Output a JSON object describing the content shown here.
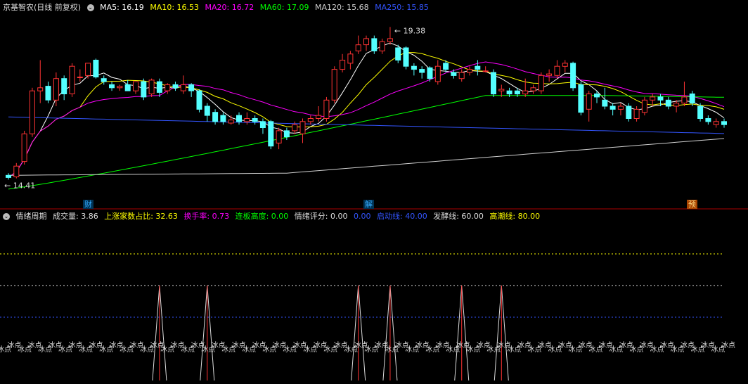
{
  "header": {
    "title": "京基智农(日线 前复权)",
    "ma": [
      {
        "label": "MA5: 16.19",
        "color": "#ffffff"
      },
      {
        "label": "MA10: 16.53",
        "color": "#ffff00"
      },
      {
        "label": "MA20: 16.72",
        "color": "#ff00ff"
      },
      {
        "label": "MA60: 17.09",
        "color": "#00ff00"
      },
      {
        "label": "MA120: 15.68",
        "color": "#d0d0d0"
      },
      {
        "label": "MA250: 15.85",
        "color": "#3355ff"
      }
    ]
  },
  "indicator_header": {
    "name": "情绪周期",
    "items": [
      {
        "label": "成交量: 3.86",
        "color": "#dddddd"
      },
      {
        "label": "上涨家数占比: 32.63",
        "color": "#ffff00"
      },
      {
        "label": "换手率: 0.73",
        "color": "#ff00ff"
      },
      {
        "label": "连板高度: 0.00",
        "color": "#00ff00"
      },
      {
        "label": "情绪评分: 0.00",
        "color": "#dddddd"
      },
      {
        "label": "0.00",
        "color": "#3355ff"
      },
      {
        "label": "启动线: 40.00",
        "color": "#3355ff"
      },
      {
        "label": "发酵线: 60.00",
        "color": "#dddddd"
      },
      {
        "label": "高潮线: 80.00",
        "color": "#ffff00"
      }
    ]
  },
  "markers": [
    {
      "label": "财",
      "color": "#33aaff"
    },
    {
      "label": "解",
      "color": "#33aaff"
    },
    {
      "label": "预",
      "color": "#ff8800"
    }
  ],
  "chart_data": [
    {
      "type": "candlestick",
      "title": "京基智农(日线 前复权)",
      "high_label": "19.38",
      "low_label": "14.41",
      "ylim": [
        13.8,
        19.8
      ],
      "candles": [
        {
          "o": 14.55,
          "c": 14.48,
          "h": 14.62,
          "l": 14.41
        },
        {
          "o": 14.5,
          "c": 14.85,
          "h": 14.95,
          "l": 14.45
        },
        {
          "o": 15.0,
          "c": 15.9,
          "h": 16.0,
          "l": 14.9
        },
        {
          "o": 15.9,
          "c": 17.3,
          "h": 17.4,
          "l": 15.8
        },
        {
          "o": 17.3,
          "c": 17.4,
          "h": 18.3,
          "l": 16.9
        },
        {
          "o": 17.45,
          "c": 17.0,
          "h": 17.6,
          "l": 16.9
        },
        {
          "o": 17.0,
          "c": 17.7,
          "h": 17.9,
          "l": 16.8
        },
        {
          "o": 17.7,
          "c": 17.2,
          "h": 17.8,
          "l": 17.0
        },
        {
          "o": 17.2,
          "c": 18.1,
          "h": 18.2,
          "l": 17.1
        },
        {
          "o": 17.75,
          "c": 17.75,
          "h": 18.0,
          "l": 17.6
        },
        {
          "o": 17.8,
          "c": 18.2,
          "h": 18.2,
          "l": 17.7
        },
        {
          "o": 18.3,
          "c": 17.75,
          "h": 18.35,
          "l": 17.7
        },
        {
          "o": 17.7,
          "c": 17.6,
          "h": 17.8,
          "l": 17.5
        },
        {
          "o": 17.5,
          "c": 17.4,
          "h": 17.6,
          "l": 17.3
        },
        {
          "o": 17.4,
          "c": 17.45,
          "h": 17.5,
          "l": 17.3
        },
        {
          "o": 17.5,
          "c": 17.3,
          "h": 17.65,
          "l": 17.3
        },
        {
          "o": 17.3,
          "c": 17.6,
          "h": 17.6,
          "l": 17.2
        },
        {
          "o": 17.6,
          "c": 17.1,
          "h": 17.7,
          "l": 17.0
        },
        {
          "o": 17.2,
          "c": 17.65,
          "h": 17.7,
          "l": 17.1
        },
        {
          "o": 17.6,
          "c": 17.25,
          "h": 17.7,
          "l": 17.1
        },
        {
          "o": 17.3,
          "c": 17.5,
          "h": 17.55,
          "l": 17.2
        },
        {
          "o": 17.5,
          "c": 17.4,
          "h": 17.6,
          "l": 17.3
        },
        {
          "o": 17.3,
          "c": 17.5,
          "h": 17.8,
          "l": 17.2
        },
        {
          "o": 17.5,
          "c": 17.3,
          "h": 17.55,
          "l": 17.1
        },
        {
          "o": 17.3,
          "c": 16.7,
          "h": 17.35,
          "l": 16.6
        },
        {
          "o": 16.8,
          "c": 16.5,
          "h": 16.9,
          "l": 16.3
        },
        {
          "o": 16.6,
          "c": 16.3,
          "h": 16.7,
          "l": 16.2
        },
        {
          "o": 16.5,
          "c": 16.3,
          "h": 16.6,
          "l": 16.2
        },
        {
          "o": 16.25,
          "c": 16.35,
          "h": 16.5,
          "l": 16.2
        },
        {
          "o": 16.5,
          "c": 16.3,
          "h": 16.6,
          "l": 16.2
        },
        {
          "o": 16.3,
          "c": 16.4,
          "h": 16.6,
          "l": 16.2
        },
        {
          "o": 16.4,
          "c": 16.3,
          "h": 16.5,
          "l": 16.2
        },
        {
          "o": 16.3,
          "c": 16.1,
          "h": 16.4,
          "l": 15.9
        },
        {
          "o": 16.3,
          "c": 15.5,
          "h": 16.35,
          "l": 15.4
        },
        {
          "o": 15.6,
          "c": 16.0,
          "h": 16.1,
          "l": 15.4
        },
        {
          "o": 16.0,
          "c": 15.8,
          "h": 16.1,
          "l": 15.7
        },
        {
          "o": 16.0,
          "c": 16.2,
          "h": 16.3,
          "l": 15.9
        },
        {
          "o": 15.9,
          "c": 16.3,
          "h": 16.4,
          "l": 15.6
        },
        {
          "o": 16.3,
          "c": 16.4,
          "h": 16.5,
          "l": 16.2
        },
        {
          "o": 16.4,
          "c": 16.5,
          "h": 16.8,
          "l": 16.3
        },
        {
          "o": 16.4,
          "c": 17.0,
          "h": 17.1,
          "l": 16.3
        },
        {
          "o": 17.0,
          "c": 18.0,
          "h": 18.1,
          "l": 16.9
        },
        {
          "o": 18.0,
          "c": 18.3,
          "h": 18.5,
          "l": 17.9
        },
        {
          "o": 18.2,
          "c": 18.5,
          "h": 18.6,
          "l": 18.0
        },
        {
          "o": 18.6,
          "c": 18.8,
          "h": 19.1,
          "l": 18.5
        },
        {
          "o": 18.8,
          "c": 19.0,
          "h": 19.1,
          "l": 18.6
        },
        {
          "o": 19.0,
          "c": 18.6,
          "h": 19.1,
          "l": 18.5
        },
        {
          "o": 18.6,
          "c": 18.9,
          "h": 19.0,
          "l": 18.5
        },
        {
          "o": 18.9,
          "c": 19.0,
          "h": 19.38,
          "l": 18.8
        },
        {
          "o": 18.7,
          "c": 18.3,
          "h": 18.8,
          "l": 18.2
        },
        {
          "o": 18.7,
          "c": 18.1,
          "h": 18.75,
          "l": 18.0
        },
        {
          "o": 18.1,
          "c": 18.0,
          "h": 18.2,
          "l": 17.8
        },
        {
          "o": 18.0,
          "c": 17.9,
          "h": 18.1,
          "l": 17.7
        },
        {
          "o": 18.05,
          "c": 17.7,
          "h": 18.1,
          "l": 17.6
        },
        {
          "o": 17.6,
          "c": 18.1,
          "h": 18.3,
          "l": 17.5
        },
        {
          "o": 18.2,
          "c": 18.0,
          "h": 18.3,
          "l": 17.9
        },
        {
          "o": 17.9,
          "c": 17.8,
          "h": 18.0,
          "l": 17.7
        },
        {
          "o": 17.7,
          "c": 17.9,
          "h": 18.0,
          "l": 17.6
        },
        {
          "o": 17.9,
          "c": 18.0,
          "h": 18.1,
          "l": 17.8
        },
        {
          "o": 18.1,
          "c": 18.0,
          "h": 18.3,
          "l": 17.8
        },
        {
          "o": 17.95,
          "c": 17.95,
          "h": 18.1,
          "l": 17.9
        },
        {
          "o": 17.9,
          "c": 17.2,
          "h": 18.0,
          "l": 17.1
        },
        {
          "o": 17.3,
          "c": 17.35,
          "h": 17.5,
          "l": 17.1
        },
        {
          "o": 17.3,
          "c": 17.2,
          "h": 17.4,
          "l": 17.1
        },
        {
          "o": 17.3,
          "c": 17.2,
          "h": 17.4,
          "l": 17.1
        },
        {
          "o": 17.2,
          "c": 17.3,
          "h": 17.7,
          "l": 17.1
        },
        {
          "o": 17.3,
          "c": 17.4,
          "h": 17.5,
          "l": 17.2
        },
        {
          "o": 17.3,
          "c": 17.8,
          "h": 17.9,
          "l": 17.2
        },
        {
          "o": 17.8,
          "c": 17.85,
          "h": 18.0,
          "l": 17.6
        },
        {
          "o": 17.8,
          "c": 18.1,
          "h": 18.3,
          "l": 17.7
        },
        {
          "o": 18.1,
          "c": 18.2,
          "h": 18.3,
          "l": 17.9
        },
        {
          "o": 18.2,
          "c": 17.4,
          "h": 18.25,
          "l": 17.3
        },
        {
          "o": 17.5,
          "c": 16.6,
          "h": 17.6,
          "l": 16.5
        },
        {
          "o": 16.7,
          "c": 17.2,
          "h": 17.3,
          "l": 16.3
        },
        {
          "o": 17.2,
          "c": 17.1,
          "h": 17.3,
          "l": 16.9
        },
        {
          "o": 17.0,
          "c": 16.8,
          "h": 17.4,
          "l": 16.7
        },
        {
          "o": 16.8,
          "c": 16.7,
          "h": 16.9,
          "l": 16.5
        },
        {
          "o": 16.7,
          "c": 16.8,
          "h": 16.9,
          "l": 16.5
        },
        {
          "o": 16.8,
          "c": 16.4,
          "h": 16.9,
          "l": 16.3
        },
        {
          "o": 16.4,
          "c": 16.7,
          "h": 16.8,
          "l": 16.3
        },
        {
          "o": 16.6,
          "c": 17.0,
          "h": 17.1,
          "l": 16.5
        },
        {
          "o": 17.0,
          "c": 17.1,
          "h": 17.2,
          "l": 16.8
        },
        {
          "o": 17.1,
          "c": 17.0,
          "h": 17.2,
          "l": 16.8
        },
        {
          "o": 17.0,
          "c": 16.8,
          "h": 17.1,
          "l": 16.7
        },
        {
          "o": 16.8,
          "c": 16.9,
          "h": 17.0,
          "l": 16.6
        },
        {
          "o": 16.9,
          "c": 17.1,
          "h": 17.6,
          "l": 16.8
        },
        {
          "o": 17.2,
          "c": 16.9,
          "h": 17.3,
          "l": 16.8
        },
        {
          "o": 16.8,
          "c": 16.4,
          "h": 16.9,
          "l": 16.3
        },
        {
          "o": 16.4,
          "c": 16.3,
          "h": 16.5,
          "l": 16.2
        },
        {
          "o": 16.2,
          "c": 16.3,
          "h": 16.4,
          "l": 16.1
        },
        {
          "o": 16.3,
          "c": 16.2,
          "h": 16.4,
          "l": 16.1
        }
      ]
    },
    {
      "type": "line",
      "title": "情绪周期",
      "ylim": [
        0,
        100
      ],
      "lines": [
        {
          "value": 80,
          "color": "#ffff00",
          "dash": true
        },
        {
          "value": 60,
          "color": "#dddddd",
          "dash": true
        },
        {
          "value": 40,
          "color": "#3355ff",
          "dash": true
        }
      ],
      "spikes": [
        {
          "index": 19,
          "height": 60
        },
        {
          "index": 25,
          "height": 60
        },
        {
          "index": 44,
          "height": 60
        },
        {
          "index": 48,
          "height": 60
        },
        {
          "index": 57,
          "height": 60
        },
        {
          "index": 62,
          "height": 60
        }
      ],
      "labels": [
        "冰点",
        "冰点",
        "冰点",
        "冰点",
        "冰点",
        "冰点",
        "冰点",
        "冰点",
        "冰点",
        "冰点",
        "冰点",
        "冰点",
        "冰点",
        "冰点",
        "冰点",
        "冰点",
        "冰点",
        "冰点",
        "冰点",
        "冰点",
        "冰点",
        "冰点",
        "冰点",
        "冰点",
        "冰点",
        "冰点",
        "冰点",
        "冰点",
        "冰点",
        "冰点",
        "冰点",
        "冰点",
        "冰点",
        "冰点",
        "冰点",
        "冰点",
        "冰点",
        "冰点",
        "冰点",
        "冰点",
        "冰点",
        "冰点",
        "冰点",
        "冰点",
        "冰点",
        "冰点",
        "冰点",
        "冰点",
        "冰点",
        "冰点",
        "冰点",
        "冰点",
        "冰点",
        "冰点",
        "冰点",
        "冰点",
        "冰点",
        "冰点",
        "冰点",
        "冰点",
        "冰点",
        "冰点",
        "冰点",
        "冰点",
        "冰点",
        "冰点",
        "冰点",
        "冰点",
        "冰点",
        "冰点",
        "冰点",
        "冰点"
      ]
    }
  ]
}
